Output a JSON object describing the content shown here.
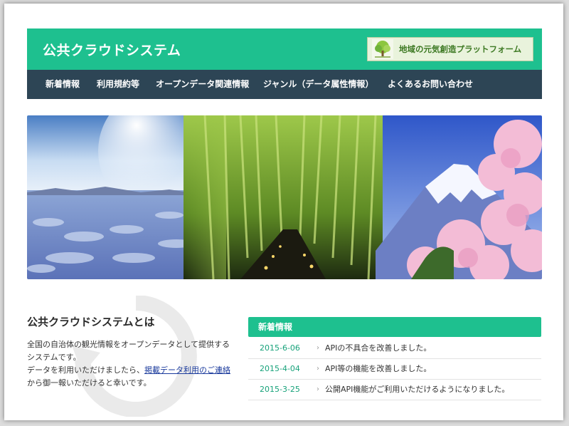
{
  "header": {
    "site_title": "公共クラウドシステム",
    "banner_text": "地域の元気創造プラットフォーム"
  },
  "nav": {
    "items": [
      {
        "label": "新着情報"
      },
      {
        "label": "利用規約等"
      },
      {
        "label": "オープンデータ関連情報"
      },
      {
        "label": "ジャンル（データ属性情報）"
      },
      {
        "label": "よくあるお問い合わせ"
      }
    ]
  },
  "about": {
    "title": "公共クラウドシステムとは",
    "line1": "全国の自治体の観光情報をオープンデータとして提供するシステムです。",
    "line2_pre": "データを利用いただけましたら、",
    "link": "掲載データ利用のご連絡",
    "line2_post": "から御一報いただけると幸いです。"
  },
  "news": {
    "heading": "新着情報",
    "items": [
      {
        "date": "2015-6-06",
        "text": "APIの不具合を改善しました。"
      },
      {
        "date": "2015-4-04",
        "text": "API等の機能を改善しました。"
      },
      {
        "date": "2015-3-25",
        "text": "公開API機能がご利用いただけるようになりました。"
      }
    ]
  },
  "colors": {
    "accent": "#1ec08f",
    "nav_bg": "#2d4555",
    "link": "#1a3a9c"
  }
}
